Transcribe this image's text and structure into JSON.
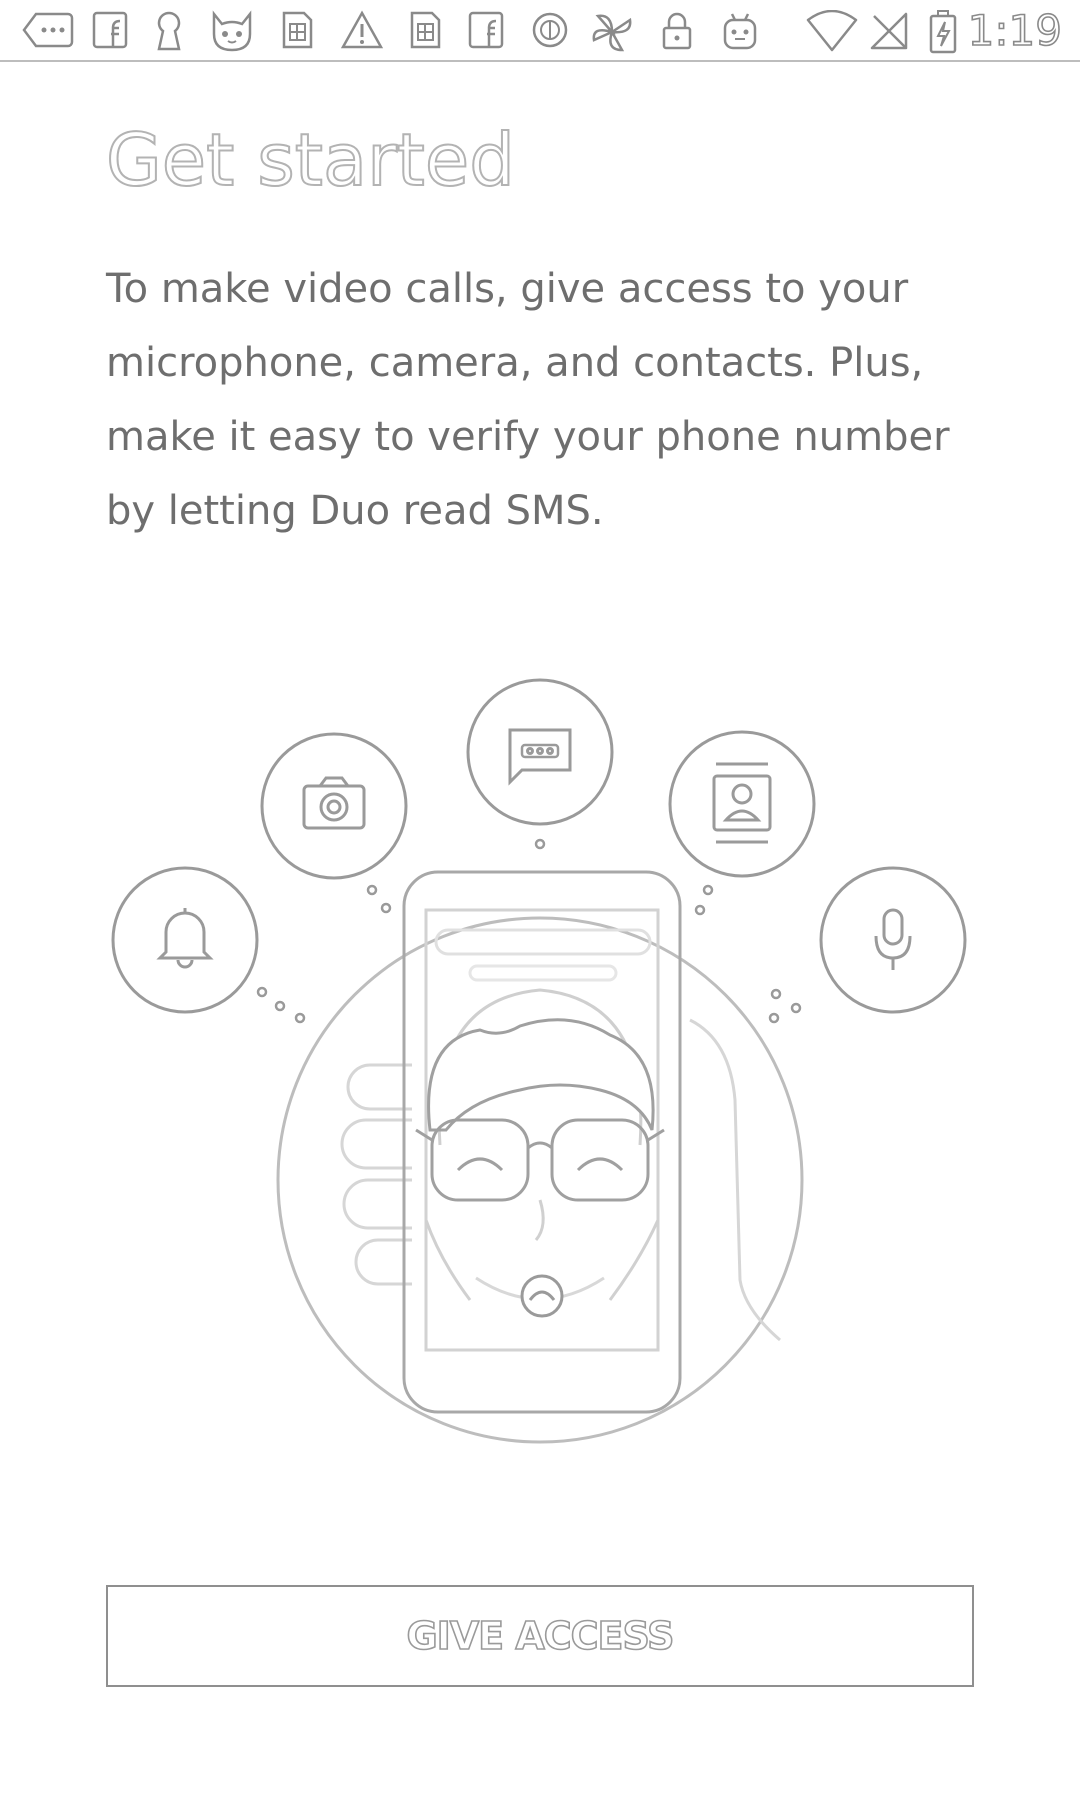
{
  "status_bar": {
    "time": "1:19",
    "icons": [
      "more-icon",
      "facebook-icon",
      "keyhole-icon",
      "cat-icon",
      "sim-icon",
      "warning-icon",
      "sim-icon",
      "facebook-icon",
      "sync-icon",
      "flower-icon",
      "lock-icon",
      "android-icon",
      "wifi-icon",
      "no-signal-icon",
      "battery-charging-icon"
    ]
  },
  "main": {
    "title": "Get started",
    "description": "To make video calls, give access to your microphone, camera, and contacts. Plus, make it easy to verify your phone number by letting Duo read SMS."
  },
  "illustration": {
    "icons": [
      "notification-bell-icon",
      "camera-icon",
      "sms-icon",
      "contacts-icon",
      "microphone-icon"
    ],
    "call_button_icon": "end-call-icon"
  },
  "actions": {
    "give_access_label": "GIVE ACCESS"
  }
}
